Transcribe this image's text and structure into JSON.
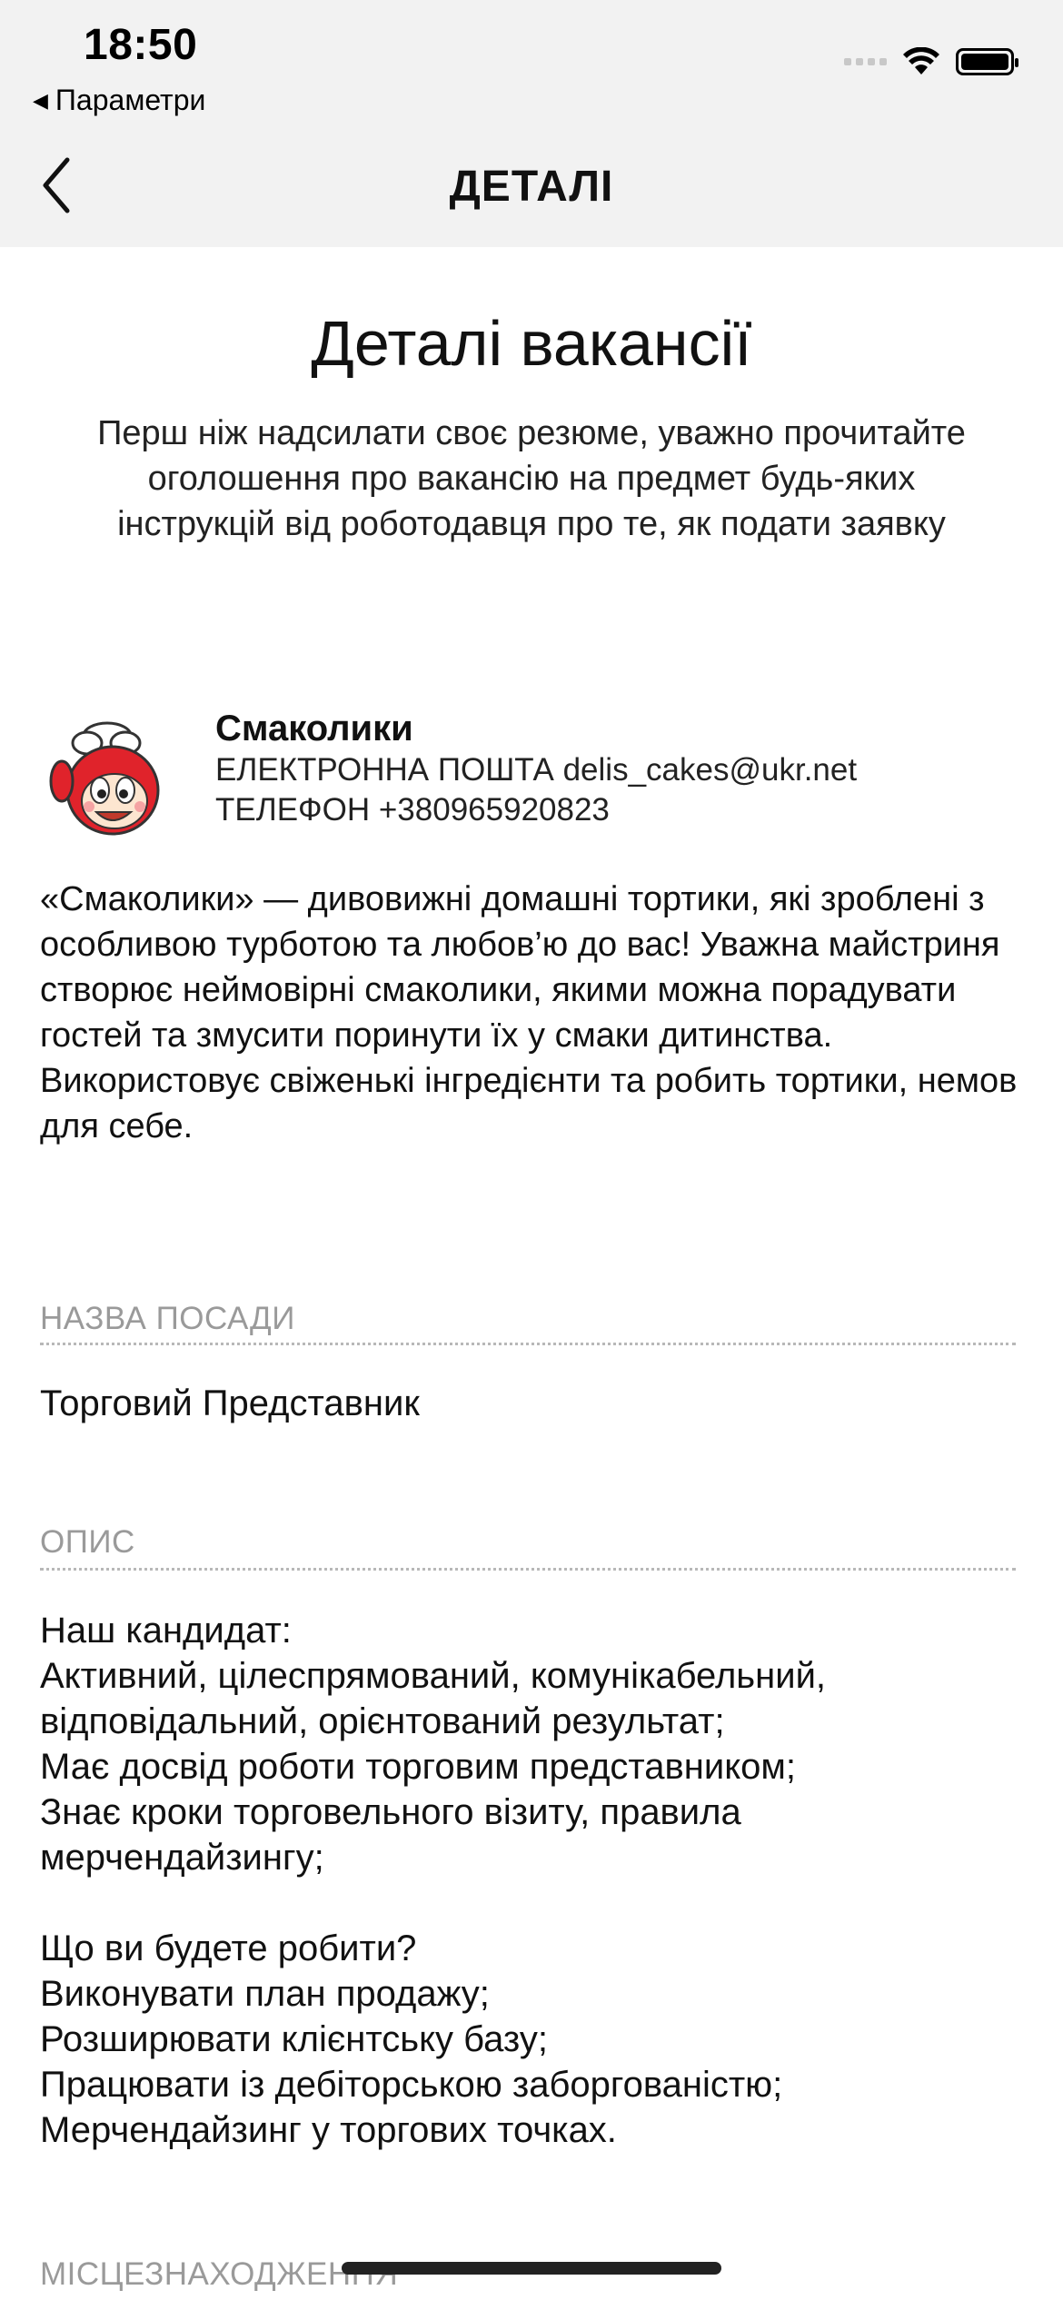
{
  "status_bar": {
    "time": "18:50",
    "back_app_label": "Параметри"
  },
  "nav": {
    "title": "ДЕТАЛІ"
  },
  "page": {
    "title": "Деталі вакансії",
    "intro": "Перш ніж надсилати своє резюме, уважно прочитайте оголошення про вакансію на предмет будь-яких інструкцій від роботодавця про те, як подати заявку"
  },
  "employer": {
    "name": "Смаколики",
    "email_line": "ЕЛЕКТРОННА ПОШТА delis_cakes@ukr.net",
    "phone_line": "ТЕЛЕФОН +380965920823"
  },
  "description": "«Смаколики» — дивовижні домашні тортики, які зроблені з особливою турботою та любов’ю до вас! Уважна майстриня створює неймовірні смаколики, якими можна порадувати гостей та змусити поринути їх у смаки дитинства.\n Використовує свіженькі інгредієнти та робить тортики, немов для себе.",
  "sections": {
    "position": {
      "label": "НАЗВА ПОСАДИ",
      "value": "Торговий Представник"
    },
    "details": {
      "label": "ОПИС",
      "value": "Наш кандидат:\nАктивний, цілеспрямований, комунікабельний, відповідальний, орієнтований результат;\nМає досвід роботи торговим представником;\nЗнає кроки торговельного візиту, правила мерчендайзингу;\n\nЩо ви будете робити?\nВиконувати план продажу;\nРозширювати клієнтську базу;\nПрацювати із дебіторською заборгованістю;\nМерчендайзинг у торгових точках."
    },
    "location": {
      "label": "МІСЦЕЗНАХОДЖЕННЯ"
    }
  },
  "colors": {
    "header_bg": "#f2f2f2",
    "label_gray": "#9a9a9a",
    "logo_red": "#e0232b"
  }
}
